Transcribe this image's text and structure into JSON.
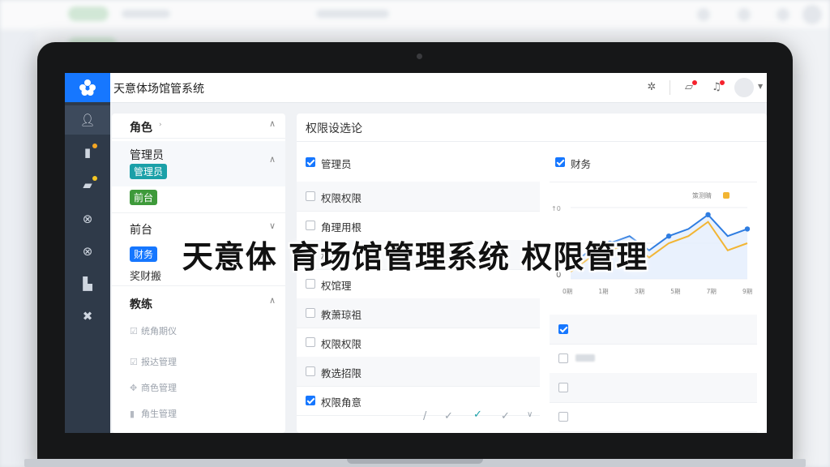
{
  "app": {
    "title": "天意体场馆管系统"
  },
  "roles": {
    "header": "角色",
    "groups": [
      {
        "title": "管理员",
        "tag": "管理员",
        "tag2": "前台"
      },
      {
        "title": "前台",
        "tag": "财务",
        "extra": "奖财搬"
      },
      {
        "title": "教练",
        "items": [
          "统角期仪",
          "报达管理",
          "商色管理",
          "角生管理"
        ]
      }
    ]
  },
  "permissions": {
    "title": "权限设选论",
    "columns": [
      {
        "label": "管理员",
        "checked": true
      },
      {
        "label": "财务",
        "checked": true
      }
    ],
    "rows": [
      {
        "label": "权限权限",
        "checked": false
      },
      {
        "label": "角理用根",
        "checked": false
      },
      {
        "label": "权限管",
        "checked": false
      },
      {
        "label": "权馆理",
        "checked": false
      },
      {
        "label": "教萧琼祖",
        "checked": false
      },
      {
        "label": "权限权限",
        "checked": false
      },
      {
        "label": "教选招限",
        "checked": false
      },
      {
        "label": "权限角意",
        "checked": true
      }
    ],
    "col2_checks": [
      false,
      true,
      false,
      false,
      false
    ]
  },
  "chart_data": {
    "type": "line",
    "legend": "策测睛",
    "y_ticks": [
      "↑0",
      "0"
    ],
    "categories": [
      "0期",
      "1期",
      "3期",
      "5期",
      "7期",
      "9期"
    ],
    "series": [
      {
        "values": [
          2,
          4,
          5,
          6,
          4,
          6,
          7,
          9,
          6,
          7
        ]
      },
      {
        "values": [
          1,
          3,
          4,
          5,
          3,
          5,
          6,
          8,
          4,
          5
        ]
      }
    ],
    "ylim": [
      0,
      10
    ]
  },
  "overlay": {
    "text": "天意体 育场馆管理系统 权限管理"
  },
  "colors": {
    "accent": "#1677ff",
    "rail": "#2f3a49",
    "chart_line": "#2f7de1",
    "chart_line2": "#f2b533"
  }
}
